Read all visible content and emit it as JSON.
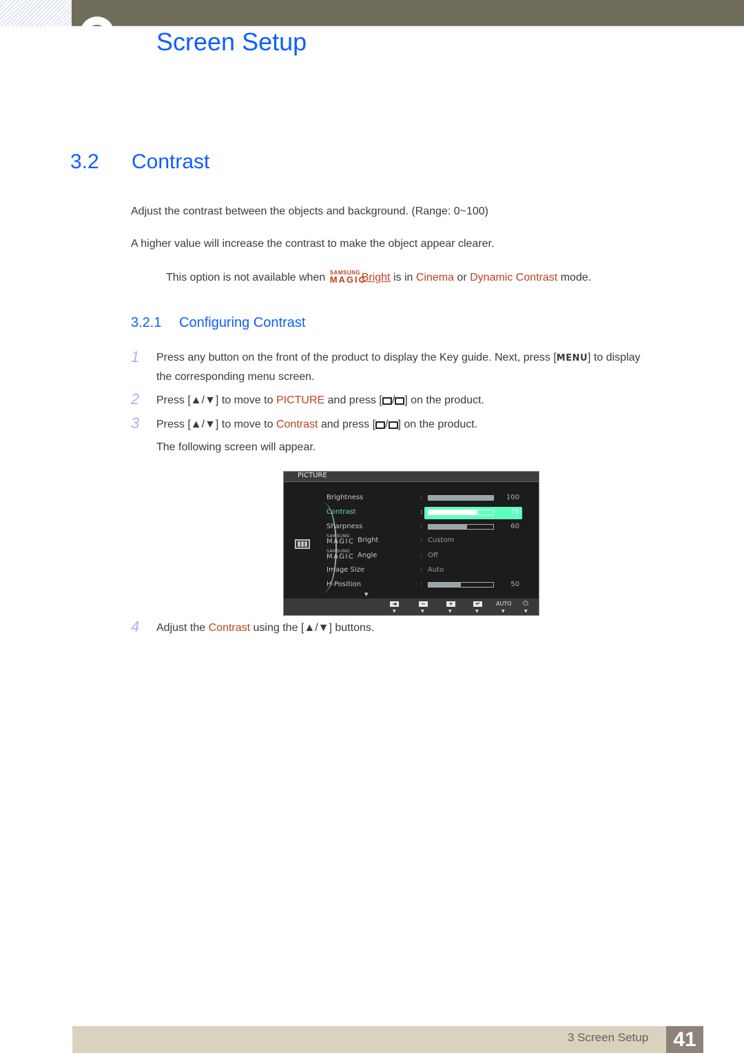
{
  "header": {
    "chapter_title": "Screen Setup"
  },
  "section": {
    "number": "3.2",
    "title": "Contrast",
    "paragraphs": [
      "Adjust the contrast between the objects and background. (Range: 0~100)",
      "A higher value will increase the contrast to make the object appear clearer."
    ],
    "note": {
      "prefix": "This option is not available when ",
      "magic_top": "SAMSUNG",
      "magic_bottom": "MAGIC",
      "bright": "Bright",
      "middle": " is in ",
      "cinema": "Cinema",
      "or": " or ",
      "dynamic": "Dynamic Contrast",
      "suffix": " mode."
    }
  },
  "subsection": {
    "number": "3.2.1",
    "title": "Configuring Contrast"
  },
  "steps": [
    {
      "num": "1",
      "line1_a": "Press any button on the front of the product to display the Key guide. Next, press [",
      "key": "MENU",
      "line1_b": "] to display",
      "line2": "the corresponding menu screen."
    },
    {
      "num": "2",
      "a": "Press [",
      "arrows": "▲/▼",
      "b": "] to move to ",
      "target": "PICTURE",
      "c": " and press [",
      "d": "] on the product."
    },
    {
      "num": "3",
      "a": "Press [",
      "arrows": "▲/▼",
      "b": "] to move to ",
      "target": "Contrast",
      "c": " and press [",
      "d": "] on the product.",
      "after": "The following screen will appear."
    },
    {
      "num": "4",
      "a": "Adjust the ",
      "target": "Contrast",
      "b": " using the [",
      "arrows": "▲/▼",
      "c": "] buttons."
    }
  ],
  "osd": {
    "title": "PICTURE",
    "rows": [
      {
        "label": "Brightness",
        "type": "bar",
        "value": 100
      },
      {
        "label": "Contrast",
        "type": "bar",
        "value": 75,
        "selected": true
      },
      {
        "label": "Sharpness",
        "type": "bar",
        "value": 60
      },
      {
        "label_top": "SAMSUNG",
        "label_mid": "MAGIC",
        "label": "Bright",
        "type": "text",
        "value": "Custom"
      },
      {
        "label_top": "SAMSUNG",
        "label_mid": "MAGIC",
        "label": "Angle",
        "type": "text",
        "value": "Off"
      },
      {
        "label": "Image Size",
        "type": "text",
        "value": "Auto"
      },
      {
        "label": "H-Position",
        "type": "bar",
        "value": 50
      }
    ],
    "colon": ":",
    "footer": {
      "buttons": [
        "◄",
        "−",
        "+",
        "↵"
      ],
      "auto": "AUTO",
      "power": "⏻",
      "arrow": "▼"
    },
    "more_indicator": "▼",
    "colors": {
      "highlight": "#5fffbe",
      "selected_text": "#5fe0a9"
    }
  },
  "footer": {
    "label": "3 Screen Setup",
    "page": "41"
  },
  "colors": {
    "heading_blue": "#0d5eff",
    "accent_orange": "#c0431a",
    "topbar": "#6f6d5a",
    "footer_bg": "#d8d2bf",
    "page_box": "#8e8378"
  }
}
